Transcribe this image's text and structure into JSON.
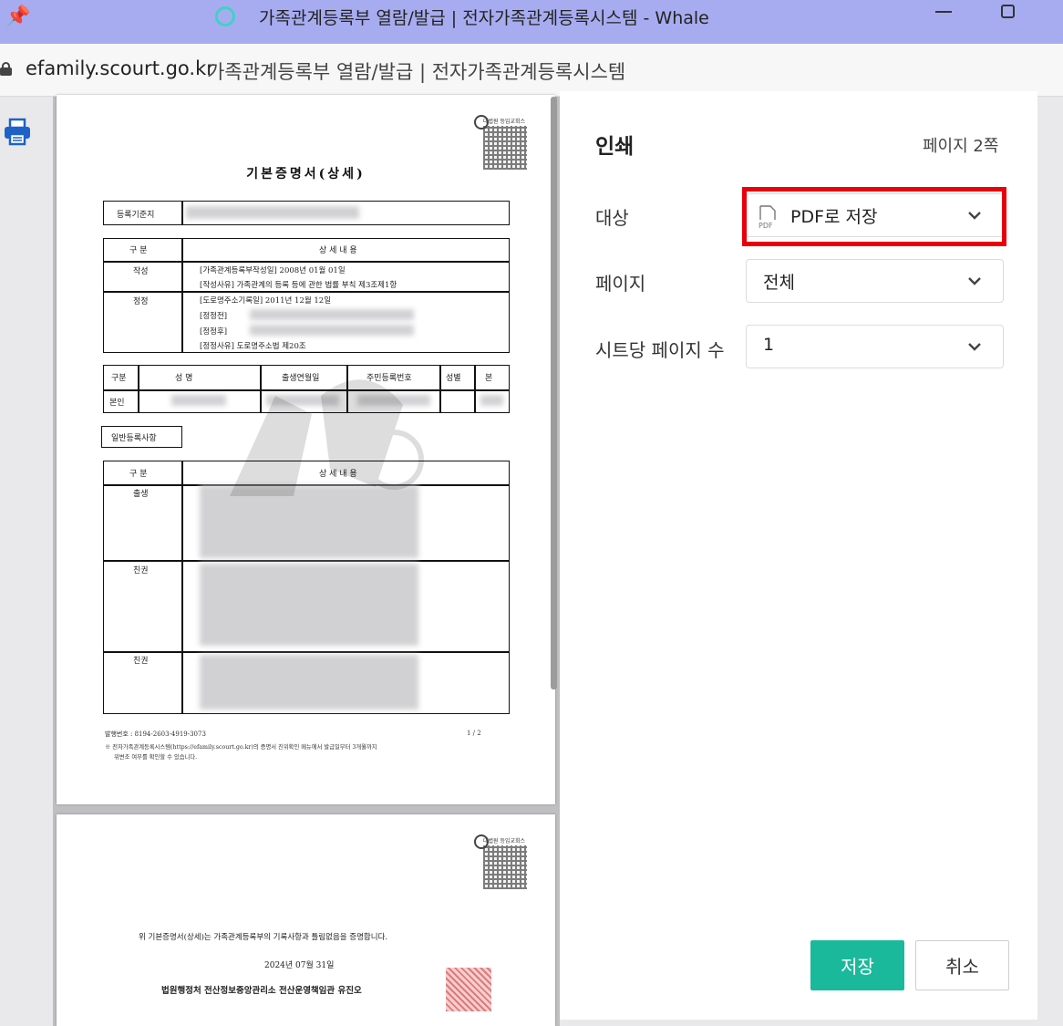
{
  "window": {
    "title": "가족관계등록부 열람/발급 | 전자가족관계등록시스템 - Whale"
  },
  "address_bar": {
    "domain": "efamily.scourt.go.kr",
    "page_title": "가족관계등록부 열람/발급 | 전자가족관계등록시스템"
  },
  "document": {
    "title": "기본증명서(상세)",
    "qr_label": "대법원 등입교회스",
    "reg_base_label": "등록기준지",
    "section_header": "구 분",
    "detail_header": "상 세 내 용",
    "row_create": "작성",
    "create_line1": "[가족관계등록부작성일]     2008년 01월 01일",
    "create_line2": "[작성사유]    가족관계의 등록 등에 관한 법률 부칙 제3조제1항",
    "row_correct": "정정",
    "correct_line1": "[도로명주소기록일]     2011년 12월 12일",
    "correct_line2": "[정정전]",
    "correct_line3": "[정정후]",
    "correct_line4": "[정정사유]    도로명주소법 제20조",
    "person_headers": [
      "구분",
      "성   명",
      "출생연월일",
      "주민등록번호",
      "성별",
      "본"
    ],
    "person_row": "본인",
    "general_label": "일반등록사항",
    "row_birth": "출생",
    "row_kin1": "친권",
    "row_kin2": "친권",
    "footer_issue": "발행번호 : 8194-2603-4919-3073",
    "footer_page": "1  /  2",
    "footer_note1": "※ 전자가족관계등록시스템(https://efamily.scourt.go.kr)의 증명서 진위확인 메뉴에서 발급일부터 3개월까지",
    "footer_note2": "위변조 여부를 확인할 수 있습니다.",
    "p2_statement": "위 기본증명서(상세)는 가족관계등록부의 기록사항과 틀림없음을 증명합니다.",
    "p2_date": "2024년 07월 31일",
    "p2_issuer": "법원행정처 전산정보중앙관리소 전산운영책임관 유진오"
  },
  "print_panel": {
    "heading": "인쇄",
    "page_count": "페이지 2쪽",
    "destination_label": "대상",
    "destination_value": "PDF로 저장",
    "pages_label": "페이지",
    "pages_value": "전체",
    "per_sheet_label": "시트당 페이지 수",
    "per_sheet_value": "1",
    "save_label": "저장",
    "cancel_label": "취소"
  },
  "colors": {
    "titlebar": "#a7acf0",
    "highlight": "#e8000b",
    "save_button": "#1bb99c",
    "logo_ring": "#3fd1c6"
  }
}
